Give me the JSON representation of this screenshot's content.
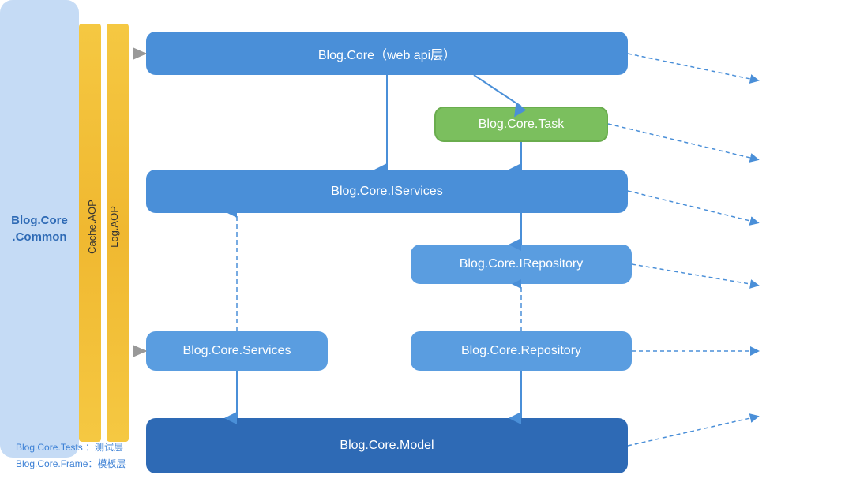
{
  "boxes": {
    "webapi": {
      "label": "Blog.Core（web api层）"
    },
    "task": {
      "label": "Blog.Core.Task"
    },
    "iservices": {
      "label": "Blog.Core.IServices"
    },
    "irepository": {
      "label": "Blog.Core.IRepository"
    },
    "services": {
      "label": "Blog.Core.Services"
    },
    "repository": {
      "label": "Blog.Core.Repository"
    },
    "model": {
      "label": "Blog.Core.Model"
    },
    "common": {
      "label": "Blog.Core\n.Common"
    }
  },
  "bars": {
    "cache": {
      "label": "Cache.AOP"
    },
    "log": {
      "label": "Log.AOP"
    }
  },
  "notes": {
    "line1": "Blog.Core.Tests ：测试层",
    "line2": "Blog.Core.Frame：模板层"
  }
}
